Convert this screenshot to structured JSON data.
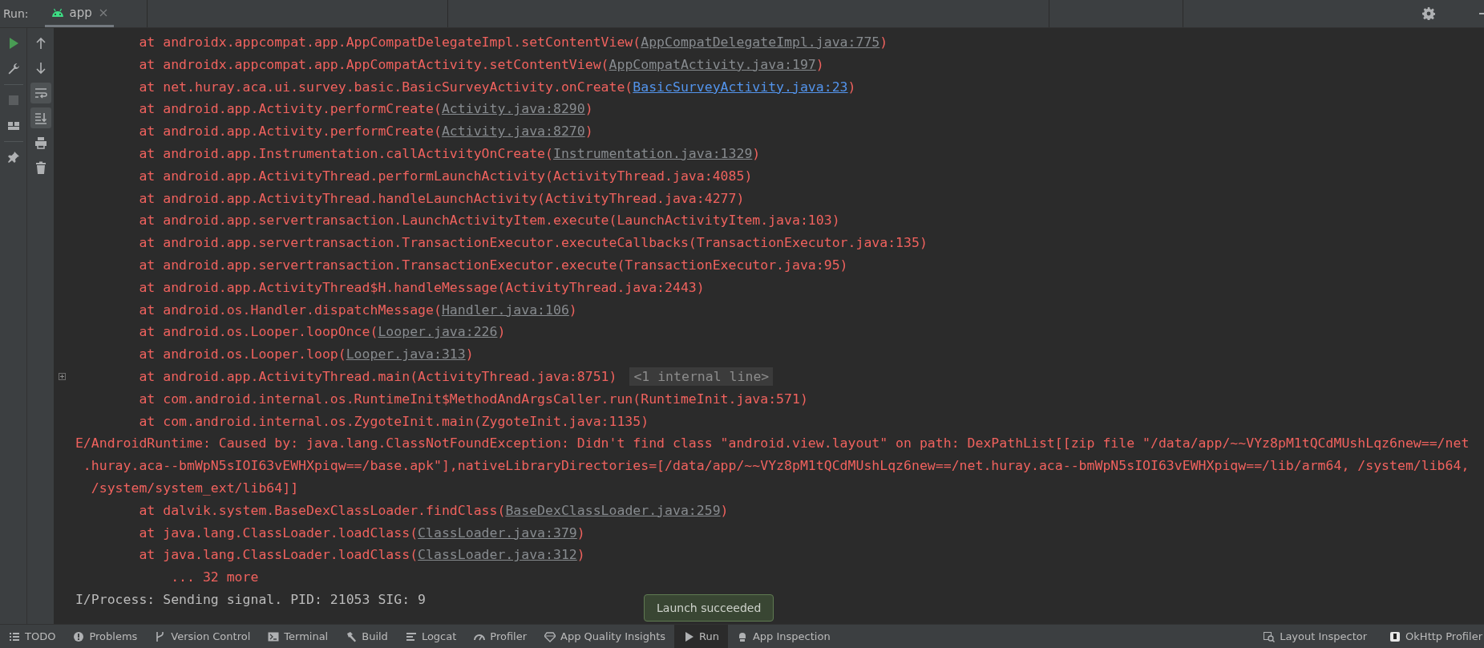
{
  "run_bar": {
    "label": "Run:",
    "tabs": [
      {
        "label": "app",
        "selected": true
      }
    ]
  },
  "run_toolbar": [
    {
      "kind": "run",
      "disabled": false
    },
    {
      "kind": "wrench",
      "disabled": false
    },
    {
      "kind": "separator"
    },
    {
      "kind": "stop",
      "disabled": true
    },
    {
      "kind": "layout",
      "disabled": false
    },
    {
      "kind": "separator"
    },
    {
      "kind": "pin",
      "disabled": false
    }
  ],
  "console_toolbar": [
    {
      "kind": "up",
      "selected": false
    },
    {
      "kind": "down",
      "selected": false
    },
    {
      "kind": "soft-wrap",
      "selected": true
    },
    {
      "kind": "scroll-end",
      "selected": true
    },
    {
      "kind": "print",
      "selected": false
    },
    {
      "kind": "trash",
      "selected": false
    }
  ],
  "console": [
    {
      "kind": "frame",
      "segments": [
        {
          "kind": "text",
          "text": "at androidx.appcompat.app.AppCompatDelegateImpl.setContentView("
        },
        {
          "kind": "link",
          "text": "AppCompatDelegateImpl.java:775"
        },
        {
          "kind": "text",
          "text": ")"
        }
      ]
    },
    {
      "kind": "frame",
      "segments": [
        {
          "kind": "text",
          "text": "at androidx.appcompat.app.AppCompatActivity.setContentView("
        },
        {
          "kind": "link",
          "text": "AppCompatActivity.java:197"
        },
        {
          "kind": "text",
          "text": ")"
        }
      ]
    },
    {
      "kind": "frame",
      "segments": [
        {
          "kind": "text",
          "text": "at net.huray.aca.ui.survey.basic.BasicSurveyActivity.onCreate("
        },
        {
          "kind": "project_link",
          "text": "BasicSurveyActivity.java:23"
        },
        {
          "kind": "text",
          "text": ")"
        }
      ]
    },
    {
      "kind": "frame",
      "segments": [
        {
          "kind": "text",
          "text": "at android.app.Activity.performCreate("
        },
        {
          "kind": "link",
          "text": "Activity.java:8290"
        },
        {
          "kind": "text",
          "text": ")"
        }
      ]
    },
    {
      "kind": "frame",
      "segments": [
        {
          "kind": "text",
          "text": "at android.app.Activity.performCreate("
        },
        {
          "kind": "link",
          "text": "Activity.java:8270"
        },
        {
          "kind": "text",
          "text": ")"
        }
      ]
    },
    {
      "kind": "frame",
      "segments": [
        {
          "kind": "text",
          "text": "at android.app.Instrumentation.callActivityOnCreate("
        },
        {
          "kind": "link",
          "text": "Instrumentation.java:1329"
        },
        {
          "kind": "text",
          "text": ")"
        }
      ]
    },
    {
      "kind": "frame",
      "segments": [
        {
          "kind": "text",
          "text": "at android.app.ActivityThread.performLaunchActivity(ActivityThread.java:4085)"
        }
      ]
    },
    {
      "kind": "frame",
      "segments": [
        {
          "kind": "text",
          "text": "at android.app.ActivityThread.handleLaunchActivity(ActivityThread.java:4277)"
        }
      ]
    },
    {
      "kind": "frame",
      "segments": [
        {
          "kind": "text",
          "text": "at android.app.servertransaction.LaunchActivityItem.execute(LaunchActivityItem.java:103)"
        }
      ]
    },
    {
      "kind": "frame",
      "segments": [
        {
          "kind": "text",
          "text": "at android.app.servertransaction.TransactionExecutor.executeCallbacks(TransactionExecutor.java:135)"
        }
      ]
    },
    {
      "kind": "frame",
      "segments": [
        {
          "kind": "text",
          "text": "at android.app.servertransaction.TransactionExecutor.execute(TransactionExecutor.java:95)"
        }
      ]
    },
    {
      "kind": "frame",
      "segments": [
        {
          "kind": "text",
          "text": "at android.app.ActivityThread$H.handleMessage(ActivityThread.java:2443)"
        }
      ]
    },
    {
      "kind": "frame",
      "segments": [
        {
          "kind": "text",
          "text": "at android.os.Handler.dispatchMessage("
        },
        {
          "kind": "link",
          "text": "Handler.java:106"
        },
        {
          "kind": "text",
          "text": ")"
        }
      ]
    },
    {
      "kind": "frame",
      "segments": [
        {
          "kind": "text",
          "text": "at android.os.Looper.loopOnce("
        },
        {
          "kind": "link",
          "text": "Looper.java:226"
        },
        {
          "kind": "text",
          "text": ")"
        }
      ]
    },
    {
      "kind": "frame",
      "segments": [
        {
          "kind": "text",
          "text": "at android.os.Looper.loop("
        },
        {
          "kind": "link",
          "text": "Looper.java:313"
        },
        {
          "kind": "text",
          "text": ")"
        }
      ]
    },
    {
      "kind": "frame",
      "segments": [
        {
          "kind": "text",
          "text": "at android.app.ActivityThread.main(ActivityThread.java:8751)"
        }
      ],
      "folded": "<1 internal line>"
    },
    {
      "kind": "frame",
      "segments": [
        {
          "kind": "text",
          "text": "at com.android.internal.os.RuntimeInit$MethodAndArgsCaller.run(RuntimeInit.java:571)"
        }
      ]
    },
    {
      "kind": "frame",
      "segments": [
        {
          "kind": "text",
          "text": "at com.android.internal.os.ZygoteInit.main(ZygoteInit.java:1135)"
        }
      ]
    },
    {
      "kind": "error",
      "segments": [
        {
          "kind": "text",
          "text": "E/AndroidRuntime: Caused by: java.lang.ClassNotFoundException: Didn't find class \"android.view.layout\" on path: DexPathList[[zip file \"/data/app/~~VYz8pM1tQCdMUshLqz6new==/net"
        }
      ]
    },
    {
      "kind": "wrap",
      "segments": [
        {
          "kind": "text",
          "text": ".huray.aca--bmWpN5sIOI63vEWHXpiqw==/base.apk\"],nativeLibraryDirectories=[/data/app/~~VYz8pM1tQCdMUshLqz6new==/net.huray.aca--bmWpN5sIOI63vEWHXpiqw==/lib/arm64, /system/lib64,"
        }
      ]
    },
    {
      "kind": "wrap2",
      "segments": [
        {
          "kind": "text",
          "text": "/system/system_ext/lib64]]"
        }
      ]
    },
    {
      "kind": "frame",
      "segments": [
        {
          "kind": "text",
          "text": "at dalvik.system.BaseDexClassLoader.findClass("
        },
        {
          "kind": "link",
          "text": "BaseDexClassLoader.java:259"
        },
        {
          "kind": "text",
          "text": ")"
        }
      ]
    },
    {
      "kind": "frame",
      "segments": [
        {
          "kind": "text",
          "text": "at java.lang.ClassLoader.loadClass("
        },
        {
          "kind": "link",
          "text": "ClassLoader.java:379"
        },
        {
          "kind": "text",
          "text": ")"
        }
      ]
    },
    {
      "kind": "frame",
      "segments": [
        {
          "kind": "text",
          "text": "at java.lang.ClassLoader.loadClass("
        },
        {
          "kind": "link",
          "text": "ClassLoader.java:312"
        },
        {
          "kind": "text",
          "text": ")"
        }
      ]
    },
    {
      "kind": "more",
      "segments": [
        {
          "kind": "text",
          "text": "... 32 more"
        }
      ]
    },
    {
      "kind": "info",
      "segments": [
        {
          "kind": "text",
          "text": "I/Process: Sending signal. PID: 21053 SIG: 9"
        }
      ]
    }
  ],
  "toast": {
    "text": "Launch succeeded"
  },
  "status_bar": {
    "left": [
      {
        "kind": "list",
        "label": "TODO",
        "selected": false
      },
      {
        "kind": "info",
        "label": "Problems",
        "selected": false
      },
      {
        "kind": "branch",
        "label": "Version Control",
        "selected": false
      },
      {
        "kind": "terminal",
        "label": "Terminal",
        "selected": false
      },
      {
        "kind": "hammer",
        "label": "Build",
        "selected": false
      },
      {
        "kind": "logcat",
        "label": "Logcat",
        "selected": false
      },
      {
        "kind": "gauge",
        "label": "Profiler",
        "selected": false
      },
      {
        "kind": "diamond",
        "label": "App Quality Insights",
        "selected": false
      },
      {
        "kind": "play",
        "label": "Run",
        "selected": true
      },
      {
        "kind": "robot",
        "label": "App Inspection",
        "selected": false
      }
    ],
    "right": [
      {
        "kind": "inspector",
        "label": "Layout Inspector",
        "selected": false
      },
      {
        "kind": "okhttp",
        "label": "OkHttp Profiler",
        "selected": false
      }
    ]
  }
}
